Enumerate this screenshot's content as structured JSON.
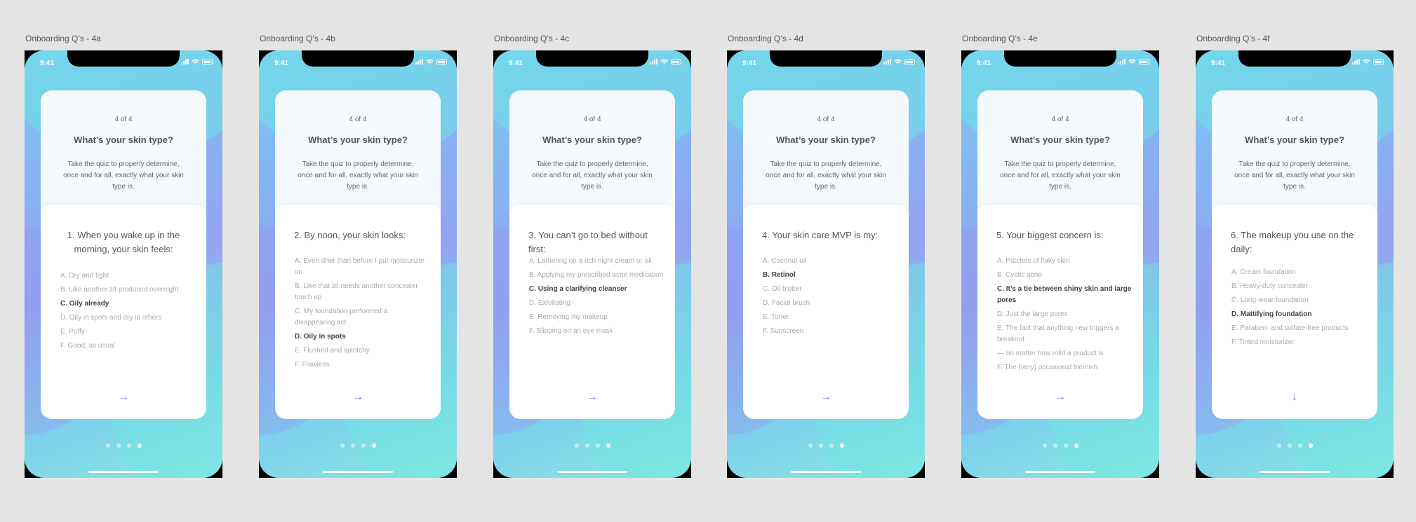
{
  "status_time": "9:41",
  "progress": "4 of 4",
  "title": "What’s your skin type?",
  "description": "Take the quiz to properly determine, once and for all, exactly what your skin type is.",
  "next_icon": "arrow-right-icon",
  "accent_color": "#7378e9",
  "boards": [
    {
      "label": "Onboarding Q’s - 4a",
      "question": "1. When you wake up in the morning, your skin feels:",
      "options": [
        {
          "text": "A. Dry and tight",
          "selected": false
        },
        {
          "text": "B. Like another zit produced overnight",
          "selected": false
        },
        {
          "text": "C. Oily already",
          "selected": true
        },
        {
          "text": "D. Oily in spots and dry in others",
          "selected": false
        },
        {
          "text": "E. Puffy",
          "selected": false
        },
        {
          "text": "F. Good, as usual",
          "selected": false
        }
      ],
      "arrow": "→"
    },
    {
      "label": "Onboarding Q’s - 4b",
      "question": "2. By noon, your skin looks:",
      "options": [
        {
          "text": "A. Even drier than before I put moisturizer on",
          "selected": false
        },
        {
          "text": "B. Like that zit needs another concealer touch up",
          "selected": false
        },
        {
          "text": "C. My foundation performed a disappearing act",
          "selected": false
        },
        {
          "text": "D. Oily in spots",
          "selected": true
        },
        {
          "text": "E. Flushed and splotchy",
          "selected": false
        },
        {
          "text": "F. Flawless",
          "selected": false
        }
      ],
      "arrow": "→"
    },
    {
      "label": "Onboarding Q’s - 4c",
      "question": "3. You can’t go to bed without first:",
      "options": [
        {
          "text": "A. Lathering on a rich night cream or oil",
          "selected": false
        },
        {
          "text": "B. Applying my prescribed acne medication",
          "selected": false
        },
        {
          "text": "C. Using a clarifying cleanser",
          "selected": true
        },
        {
          "text": "D. Exfoliating",
          "selected": false
        },
        {
          "text": "E. Removing my makeup",
          "selected": false
        },
        {
          "text": "F. Slipping on an eye mask",
          "selected": false
        }
      ],
      "arrow": "→"
    },
    {
      "label": "Onboarding Q’s - 4d",
      "question": "4. Your skin care MVP is my:",
      "options": [
        {
          "text": "A. Coconut oil",
          "selected": false
        },
        {
          "text": "B. Retinol",
          "selected": true
        },
        {
          "text": "C. Oil blotter",
          "selected": false
        },
        {
          "text": "D. Facial brush",
          "selected": false
        },
        {
          "text": "E. Toner",
          "selected": false
        },
        {
          "text": "F. Sunscreen",
          "selected": false
        }
      ],
      "arrow": "→"
    },
    {
      "label": "Onboarding Q’s - 4e",
      "question": "5. Your biggest concern is:",
      "options": [
        {
          "text": "A. Patches of flaky skin",
          "selected": false
        },
        {
          "text": "B. Cystic acne",
          "selected": false
        },
        {
          "text": "C. It’s a tie between shiny skin and large pores",
          "selected": true
        },
        {
          "text": "D. Just the large pores",
          "selected": false
        },
        {
          "text": "E. The fact that anything new triggers a breakout",
          "selected": false
        },
        {
          "text": "— no matter how mild a product is",
          "selected": false
        },
        {
          "text": "F. The (very) occasional blemish",
          "selected": false
        }
      ],
      "arrow": "→"
    },
    {
      "label": "Onboarding Q’s - 4f",
      "question": "6. The makeup you use on the daily:",
      "options": [
        {
          "text": "A. Cream foundation",
          "selected": false
        },
        {
          "text": "B. Heavy-duty concealer",
          "selected": false
        },
        {
          "text": "C. Long-wear foundation",
          "selected": false
        },
        {
          "text": "D. Mattifying foundation",
          "selected": true
        },
        {
          "text": "E. Paraben- and sulfate-free products",
          "selected": false
        },
        {
          "text": "F. Tinted moisturizer",
          "selected": false
        }
      ],
      "arrow": "↓"
    }
  ]
}
